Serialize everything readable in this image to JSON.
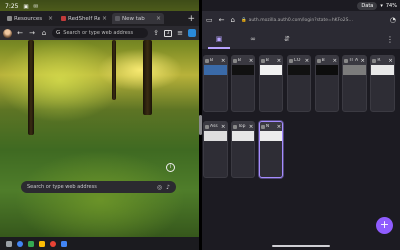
{
  "left_pane": {
    "status": {
      "time": "7:25"
    },
    "tabs": [
      {
        "title": "Resources",
        "active": false
      },
      {
        "title": "RedShelf Reader",
        "active": false
      },
      {
        "title": "New tab",
        "active": true
      }
    ],
    "toolbar": {
      "address_placeholder": "Search or type web address",
      "tab_count": "3"
    },
    "ntp": {
      "search_placeholder": "Search or type web address"
    }
  },
  "right_pane": {
    "status": {
      "app_label": "Data",
      "battery": "74%"
    },
    "url": "auth.mozilla.auth0.com/login?state=hKFo2S…",
    "tray_tabs": [
      {
        "icon": "tabs-icon",
        "active": true
      },
      {
        "icon": "private-icon",
        "active": false
      },
      {
        "icon": "synced-tabs-icon",
        "active": false
      }
    ],
    "tab_cards": [
      {
        "title": "B",
        "thumb": "#3a6aa8"
      },
      {
        "title": "B",
        "thumb": "#111111"
      },
      {
        "title": "B",
        "thumb": "#f1f1f1"
      },
      {
        "title": "CO",
        "thumb": "#111111"
      },
      {
        "title": "B",
        "thumb": "#0d0d0d"
      },
      {
        "title": "IT A",
        "thumb": "#7c7c7c"
      },
      {
        "title": "R",
        "thumb": "#e8e8e8"
      },
      {
        "title": "Ass",
        "thumb": "#dedede"
      },
      {
        "title": "Top",
        "thumb": "#e6e6e6"
      },
      {
        "title": "N",
        "thumb": "#ececec",
        "selected": true
      }
    ],
    "fab_label": "+"
  }
}
